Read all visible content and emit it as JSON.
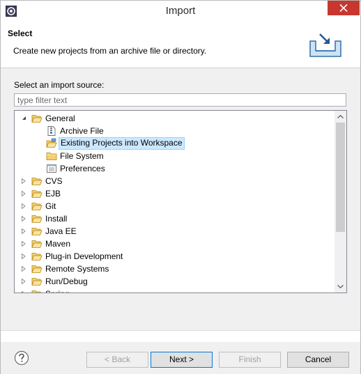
{
  "window": {
    "title": "Import"
  },
  "banner": {
    "title": "Select",
    "description": "Create new projects from an archive file or directory."
  },
  "source": {
    "label": "Select an import source:",
    "filter_placeholder": "type filter text"
  },
  "tree": [
    {
      "label": "General",
      "depth": 0,
      "expanded": true,
      "icon": "folder-open-icon"
    },
    {
      "label": "Archive File",
      "depth": 1,
      "icon": "archive-file-icon"
    },
    {
      "label": "Existing Projects into Workspace",
      "depth": 1,
      "icon": "projects-folder-icon",
      "selected": true
    },
    {
      "label": "File System",
      "depth": 1,
      "icon": "folder-icon"
    },
    {
      "label": "Preferences",
      "depth": 1,
      "icon": "preferences-icon"
    },
    {
      "label": "CVS",
      "depth": 0,
      "expanded": false,
      "icon": "folder-open-icon"
    },
    {
      "label": "EJB",
      "depth": 0,
      "expanded": false,
      "icon": "folder-open-icon"
    },
    {
      "label": "Git",
      "depth": 0,
      "expanded": false,
      "icon": "folder-open-icon"
    },
    {
      "label": "Install",
      "depth": 0,
      "expanded": false,
      "icon": "folder-open-icon"
    },
    {
      "label": "Java EE",
      "depth": 0,
      "expanded": false,
      "icon": "folder-open-icon"
    },
    {
      "label": "Maven",
      "depth": 0,
      "expanded": false,
      "icon": "folder-open-icon"
    },
    {
      "label": "Plug-in Development",
      "depth": 0,
      "expanded": false,
      "icon": "folder-open-icon"
    },
    {
      "label": "Remote Systems",
      "depth": 0,
      "expanded": false,
      "icon": "folder-open-icon"
    },
    {
      "label": "Run/Debug",
      "depth": 0,
      "expanded": false,
      "icon": "folder-open-icon"
    },
    {
      "label": "Spring",
      "depth": 0,
      "expanded": false,
      "icon": "folder-open-icon"
    }
  ],
  "buttons": {
    "back": "< Back",
    "next": "Next >",
    "finish": "Finish",
    "cancel": "Cancel"
  },
  "colors": {
    "selection": "#cce8ff",
    "close": "#c7372f",
    "folder": "#e8b84a",
    "accent": "#0078d7"
  }
}
